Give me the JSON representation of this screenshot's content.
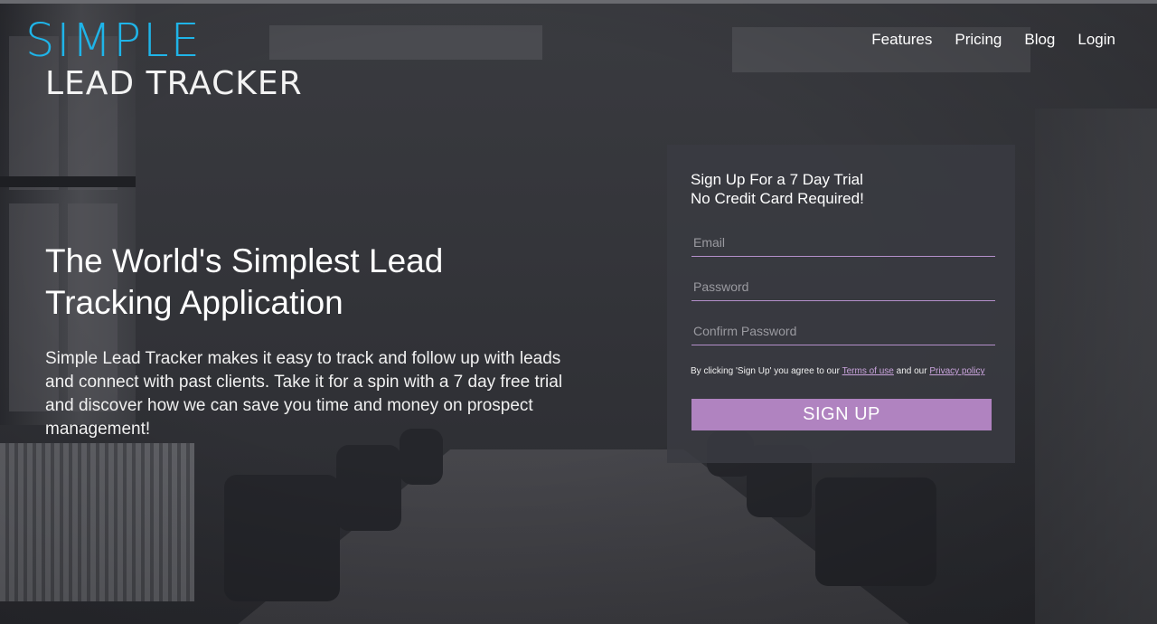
{
  "logo": {
    "line1": "SIMPLE",
    "line2": "LEAD TRACKER",
    "accent_color": "#1fb4e8"
  },
  "nav": {
    "items": [
      "Features",
      "Pricing",
      "Blog",
      "Login"
    ]
  },
  "hero": {
    "title": "The World's Simplest Lead Tracking Application",
    "text": "Simple Lead Tracker makes it easy to track and follow up with leads and connect with past clients. Take it for a spin with a 7 day free trial and discover how we can save you time and money on prospect management!"
  },
  "signup": {
    "heading_line1": "Sign Up For a 7 Day Trial",
    "heading_line2": "No Credit Card Required!",
    "email": {
      "placeholder": "Email",
      "value": ""
    },
    "password": {
      "placeholder": "Password",
      "value": ""
    },
    "confirm_password": {
      "placeholder": "Confirm Password",
      "value": ""
    },
    "terms_prefix": "By clicking 'Sign Up' you agree to our",
    "terms_link": "Terms of use",
    "terms_middle": "and our",
    "privacy_link": "Privacy policy",
    "button_label": "SIGN UP",
    "button_color": "#b083c0",
    "underline_color": "#b48fca"
  }
}
